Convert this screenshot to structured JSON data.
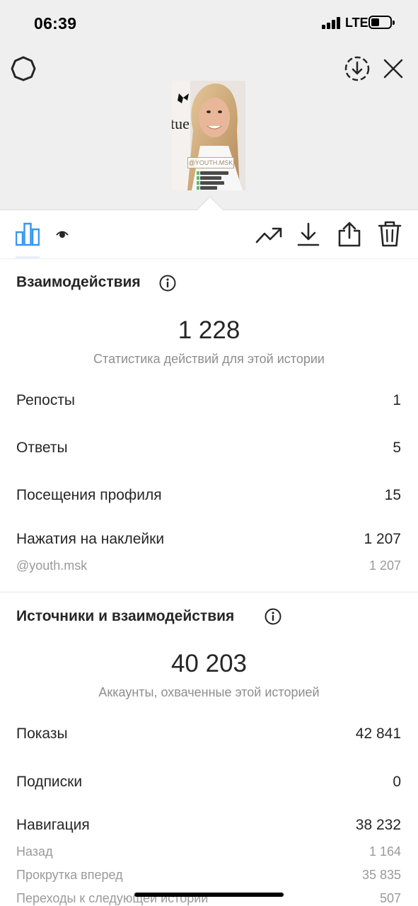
{
  "status_bar": {
    "time": "06:39",
    "network": "LTE"
  },
  "header": {
    "left_icon": "gear-icon",
    "right_icons": [
      "download-circle-icon",
      "close-icon"
    ]
  },
  "story_preview": {
    "sticker_text": "@YOUTH.MSK"
  },
  "toolbar": {
    "tabs": [
      "bar-chart-icon",
      "eye-icon"
    ],
    "actions": [
      "trending-up-icon",
      "download-icon",
      "share-icon",
      "trash-icon"
    ],
    "accent_color": "#3897f0"
  },
  "interactions": {
    "title": "Взаимодействия",
    "total": "1 228",
    "caption": "Статистика действий для этой истории",
    "rows": [
      {
        "label": "Репосты",
        "value": "1"
      },
      {
        "label": "Ответы",
        "value": "5"
      },
      {
        "label": "Посещения профиля",
        "value": "15"
      },
      {
        "label": "Нажатия на наклейки",
        "value": "1 207"
      }
    ],
    "sub_rows": [
      {
        "label": "@youth.msk",
        "value": "1 207"
      }
    ]
  },
  "discovery": {
    "title": "Источники и взаимодействия",
    "total": "40 203",
    "caption": "Аккаунты, охваченные этой историей",
    "rows": [
      {
        "label": "Показы",
        "value": "42 841"
      },
      {
        "label": "Подписки",
        "value": "0"
      },
      {
        "label": "Навигация",
        "value": "38 232"
      }
    ],
    "sub_rows": [
      {
        "label": "Назад",
        "value": "1 164"
      },
      {
        "label": "Прокрутка вперед",
        "value": "35 835"
      },
      {
        "label": "Переходы к следующей истории",
        "value": "507"
      }
    ]
  }
}
